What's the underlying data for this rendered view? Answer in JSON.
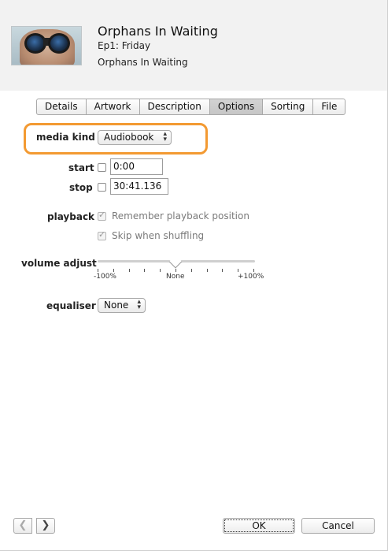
{
  "header": {
    "title": "Orphans In Waiting",
    "episode": "Ep1: Friday",
    "album": "Orphans In Waiting",
    "artwork_icon": "binoculars-artwork"
  },
  "tabs": [
    {
      "label": "Details",
      "active": false
    },
    {
      "label": "Artwork",
      "active": false
    },
    {
      "label": "Description",
      "active": false
    },
    {
      "label": "Options",
      "active": true
    },
    {
      "label": "Sorting",
      "active": false
    },
    {
      "label": "File",
      "active": false
    }
  ],
  "options": {
    "media_kind_label": "media kind",
    "media_kind_value": "Audiobook",
    "start_label": "start",
    "start_checked": false,
    "start_value": "0:00",
    "stop_label": "stop",
    "stop_checked": false,
    "stop_value": "30:41.136",
    "playback_label": "playback",
    "remember_label": "Remember playback position",
    "remember_checked": true,
    "skip_label": "Skip when shuffling",
    "skip_checked": true,
    "volume_label": "volume adjust",
    "volume_min_label": "-100%",
    "volume_mid_label": "None",
    "volume_max_label": "+100%",
    "volume_value_percent": 0,
    "equaliser_label": "equaliser",
    "equaliser_value": "None"
  },
  "footer": {
    "prev_glyph": "❮",
    "next_glyph": "❯",
    "ok_label": "OK",
    "cancel_label": "Cancel"
  },
  "colors": {
    "highlight": "#f39a32",
    "header_bg": "#f2f2f2"
  }
}
